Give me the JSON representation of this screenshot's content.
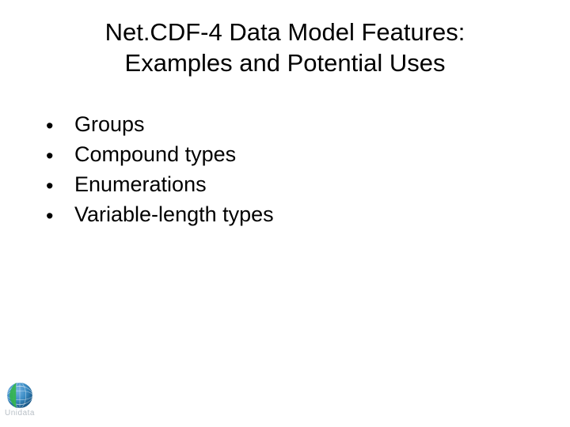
{
  "title": {
    "line1": "Net.CDF-4 Data Model Features:",
    "line2": "Examples and Potential Uses"
  },
  "bullets": [
    "Groups",
    "Compound types",
    "Enumerations",
    "Variable-length types"
  ],
  "logo": {
    "text": "Unidata"
  }
}
